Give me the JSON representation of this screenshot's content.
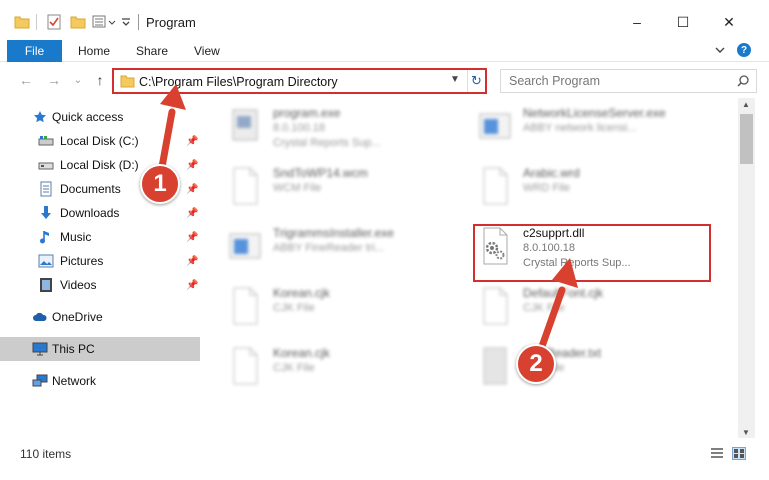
{
  "window": {
    "title": "Program",
    "controls": {
      "minimize": "–",
      "maximize": "☐",
      "close": "✕"
    }
  },
  "ribbon": {
    "tabs": [
      "File",
      "Home",
      "Share",
      "View"
    ],
    "help": "?"
  },
  "navigation": {
    "back": "←",
    "forward": "→",
    "recent": "⌄",
    "up": "↑",
    "address": "C:\\Program Files\\Program Directory",
    "refresh": "↻",
    "search_placeholder": "Search Program"
  },
  "sidebar": {
    "items": [
      {
        "label": "Quick access",
        "icon": "star-icon",
        "pinned": false
      },
      {
        "label": "Local Disk (C:)",
        "icon": "drive-icon",
        "pinned": true
      },
      {
        "label": "Local Disk (D:)",
        "icon": "drive-icon",
        "pinned": true
      },
      {
        "label": "Documents",
        "icon": "documents-icon",
        "pinned": true
      },
      {
        "label": "Downloads",
        "icon": "download-icon",
        "pinned": true
      },
      {
        "label": "Music",
        "icon": "music-icon",
        "pinned": true
      },
      {
        "label": "Pictures",
        "icon": "pictures-icon",
        "pinned": true
      },
      {
        "label": "Videos",
        "icon": "videos-icon",
        "pinned": true
      },
      {
        "label": "OneDrive",
        "icon": "cloud-icon",
        "pinned": false
      },
      {
        "label": "This PC",
        "icon": "computer-icon",
        "pinned": false,
        "selected": true
      },
      {
        "label": "Network",
        "icon": "network-icon",
        "pinned": false
      }
    ]
  },
  "files": [
    {
      "name": "program.exe",
      "detail": "8.0.100.18",
      "publisher": "Crystal Reports Sup...",
      "icon": "exe-icon",
      "blurred": true
    },
    {
      "name": "NetworkLicenseServer.exe",
      "detail": "ABBY network licensi...",
      "publisher": "",
      "icon": "app-icon",
      "blurred": true
    },
    {
      "name": "SndToWP14.wcm",
      "detail": "WCM File",
      "publisher": "",
      "icon": "blank-file-icon",
      "blurred": true
    },
    {
      "name": "Arabic.wrd",
      "detail": "WRD File",
      "publisher": "",
      "icon": "blank-file-icon",
      "blurred": true
    },
    {
      "name": "TrigrammsInstaller.exe",
      "detail": "ABBY FineReader tri...",
      "publisher": "",
      "icon": "app-icon",
      "blurred": true
    },
    {
      "name": "c2supprt.dll",
      "detail": "8.0.100.18",
      "publisher": "Crystal Reports Sup...",
      "icon": "dll-gear-icon",
      "blurred": false,
      "highlighted": true
    },
    {
      "name": "Korean.cjk",
      "detail": "CJK File",
      "publisher": "",
      "icon": "blank-file-icon",
      "blurred": true
    },
    {
      "name": "DefaultFont.cjk",
      "detail": "CJK File",
      "publisher": "",
      "icon": "blank-file-icon",
      "blurred": true
    },
    {
      "name": "Korean.cjk",
      "detail": "CJK File",
      "publisher": "",
      "icon": "blank-file-icon",
      "blurred": true
    },
    {
      "name": "FineReader.txt",
      "detail": "TXT File",
      "publisher": "",
      "icon": "text-file-icon",
      "blurred": true
    }
  ],
  "status": {
    "item_count": "110 items"
  },
  "annotations": {
    "step1": "1",
    "step2": "2",
    "color": "#d8402f"
  }
}
